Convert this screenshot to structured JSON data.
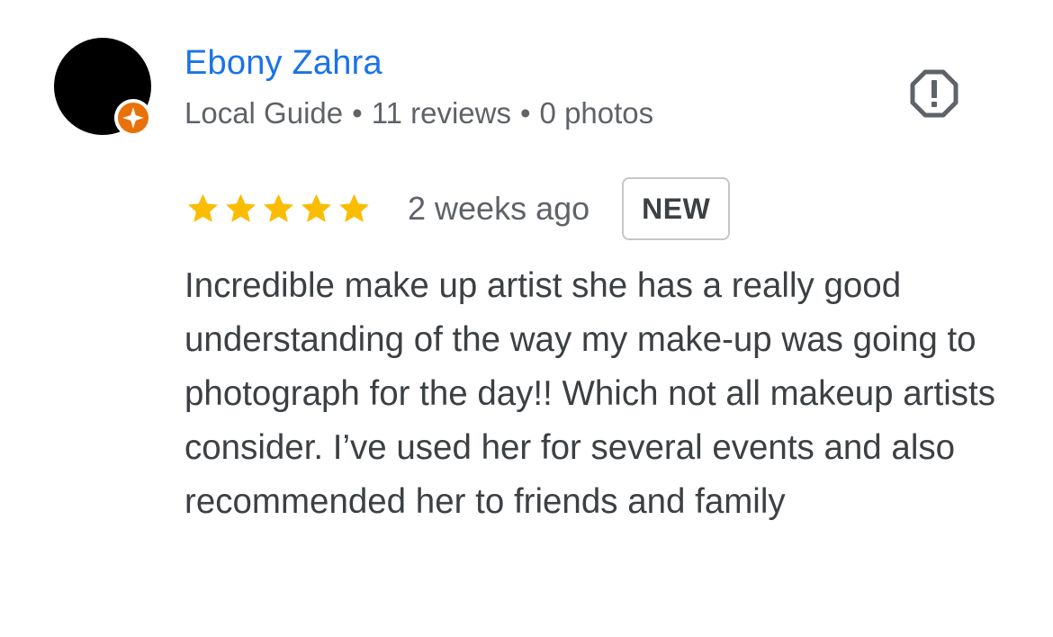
{
  "reviewer": {
    "name": "Ebony Zahra",
    "meta": {
      "badge": "Local Guide",
      "reviews": "11 reviews",
      "photos": "0 photos",
      "separator": "•"
    },
    "avatar_color": "#000000",
    "badge_color": "#e8710a"
  },
  "review": {
    "rating": 5,
    "rating_max": 5,
    "star_color": "#fbbc04",
    "date": "2 weeks ago",
    "tag": "NEW",
    "text": "Incredible make up artist she has a really good understanding of the way my make-up was going to photograph for the day!! Which not all makeup artists consider. I’ve used her for several events and also recommended her to friends and family"
  },
  "icons": {
    "report": "report-icon",
    "guide": "local-guide-star-icon",
    "star": "star-icon"
  },
  "colors": {
    "name": "#1a73e8",
    "secondary_text": "#5f6368",
    "body_text": "#3c4043"
  }
}
